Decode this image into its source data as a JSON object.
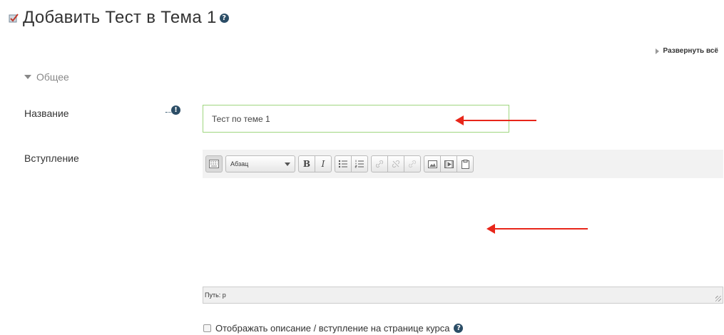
{
  "header": {
    "title": "Добавить Тест в Тема 1",
    "help_icon": "?"
  },
  "expand_all_label": "Развернуть всё",
  "section": {
    "title": "Общее"
  },
  "fields": {
    "name_label": "Название",
    "name_value": "Тест по теме 1",
    "required_icon": "!",
    "intro_label": "Вступление"
  },
  "editor": {
    "format_value": "Абзац",
    "bold": "B",
    "italic": "I",
    "status_path": "Путь: p"
  },
  "show_description": {
    "label": "Отображать описание / вступление на странице курса",
    "help_icon": "?"
  },
  "colors": {
    "accent_input_border": "#9fd67f",
    "annotation_arrow": "#e8261a",
    "help_icon_bg": "#2b4d66"
  }
}
